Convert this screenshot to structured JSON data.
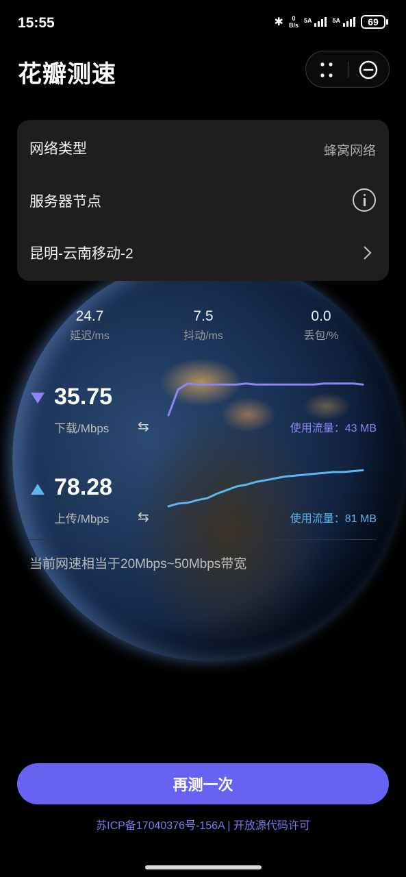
{
  "status_bar": {
    "time": "15:55",
    "net_speed_value": "0",
    "net_speed_unit": "B/s",
    "sim1_label": "5A",
    "sim2_label": "5A",
    "battery": "69"
  },
  "header": {
    "title": "花瓣测速"
  },
  "card": {
    "network_type_label": "网络类型",
    "network_type_value": "蜂窝网络",
    "server_node_label": "服务器节点",
    "server_name": "昆明-云南移动-2"
  },
  "stats": [
    {
      "value": "24.7",
      "label": "延迟/ms"
    },
    {
      "value": "7.5",
      "label": "抖动/ms"
    },
    {
      "value": "0.0",
      "label": "丢包/%"
    }
  ],
  "download": {
    "value": "35.75",
    "unit": "下载/Mbps",
    "usage": "使用流量：43 MB",
    "color": "#8e84f6",
    "curve": [
      2,
      28,
      34,
      33,
      33,
      33,
      33,
      33,
      34,
      33,
      33,
      33,
      33,
      33,
      33,
      33,
      34,
      34,
      34,
      34,
      33
    ]
  },
  "upload": {
    "value": "78.28",
    "unit": "上传/Mbps",
    "usage": "使用流量：81 MB",
    "color": "#5fb6ef",
    "curve": [
      0,
      3,
      4,
      7,
      9,
      14,
      18,
      22,
      24,
      27,
      29,
      31,
      33,
      34,
      35,
      36,
      37,
      38,
      38,
      39,
      40
    ]
  },
  "bandwidth_text": "当前网速相当于20Mbps~50Mbps带宽",
  "retest_button": "再测一次",
  "footer": "苏ICP备17040376号-156A | 开放源代码许可",
  "colors": {
    "accent": "#6862f3",
    "card_bg": "#1e1e1e",
    "background": "#000000"
  }
}
